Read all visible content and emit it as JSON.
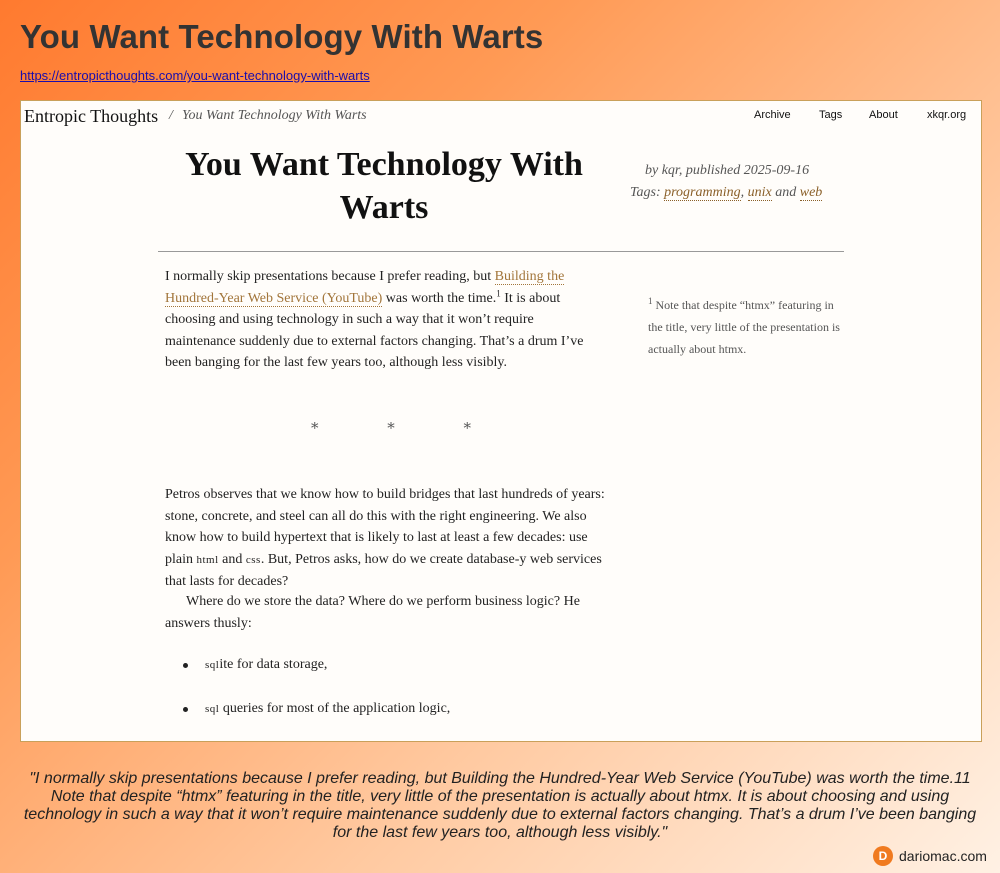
{
  "page": {
    "title": "You Want Technology With Warts",
    "url": "https://entropicthoughts.com/you-want-technology-with-warts"
  },
  "site": {
    "name": "Entropic Thoughts",
    "breadcrumb_sep": "/",
    "breadcrumb_title": "You Want Technology With Warts",
    "nav": [
      "Archive",
      "Tags",
      "About",
      "xkqr.org"
    ]
  },
  "article": {
    "title": "You Want Technology With Warts",
    "meta": {
      "byline": "by kqr, published 2025-09-16",
      "tags_label": "Tags:",
      "tags": [
        "programming",
        "unix",
        "web"
      ],
      "tag_sep": ",",
      "and_word": "and"
    },
    "p1": {
      "text_a": "I normally skip presentations because I prefer reading, but ",
      "link": "Building the Hundred-Year Web Service (YouTube)",
      "text_b": " was worth the time.",
      "fn": "1",
      "text_c": " It is about choosing and using technology in such a way that it won’t require maintenance suddenly due to external factors changing. That’s a drum I’ve been banging for the last few years too, although less visibly."
    },
    "stars": [
      "*",
      "*",
      "*"
    ],
    "p2": {
      "text_a": "Petros observes that we know how to build bridges that last hundreds of years: stone, concrete, and steel can all do this with the right engineering. We also know how to build hypertext that is likely to last at least a few decades: use plain ",
      "sc1": "html",
      "text_b": " and ",
      "sc2": "css",
      "text_c": ". But, Petros asks, how do we create database-y web services that lasts for decades?"
    },
    "p3": "Where do we store the data? Where do we perform business logic? He answers thusly:",
    "bullets": [
      {
        "sc": "sql",
        "text": "ite for data storage,"
      },
      {
        "sc": "sql",
        "text": " queries for most of the application logic,"
      }
    ],
    "sidenote": {
      "num": "1",
      "text": " Note that despite “htmx” featuring in the title, very little of the presentation is actually about htmx."
    }
  },
  "quote": "\"I normally skip presentations because I prefer reading, but Building the Hundred-Year Web Service (YouTube) was worth the time.11 Note that despite “htmx” featuring in the title, very little of the presentation is actually about htmx. It is about choosing and using technology in such a way that it won’t require maintenance suddenly due to external factors changing. That’s a drum I’ve been banging for the last few years too, although less visibly.\"",
  "brand": {
    "logo_letter": "D",
    "name": "dariomac.com",
    "logo_color": "#f07a1f"
  }
}
